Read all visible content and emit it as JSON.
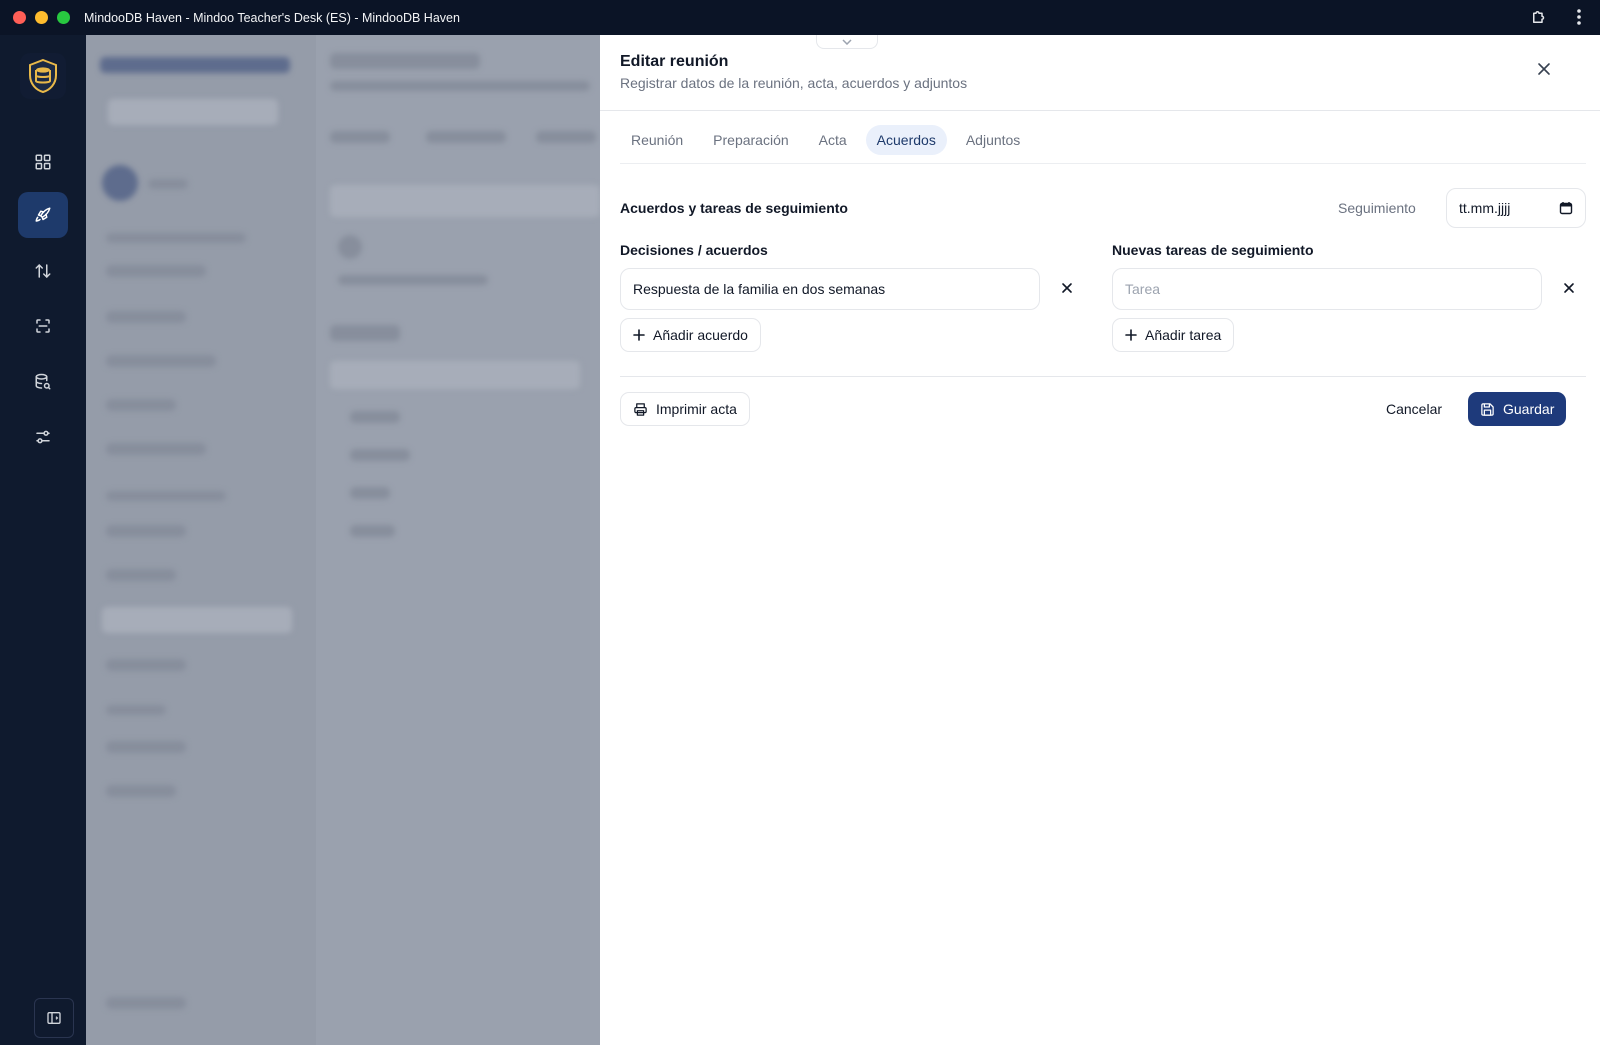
{
  "window": {
    "title": "MindooDB Haven - Mindoo Teacher's Desk (ES) - MindooDB Haven"
  },
  "sheet": {
    "title": "Editar reunión",
    "subtitle": "Registrar datos de la reunión, acta, acuerdos y adjuntos",
    "tabs": [
      {
        "label": "Reunión",
        "active": false
      },
      {
        "label": "Preparación",
        "active": false
      },
      {
        "label": "Acta",
        "active": false
      },
      {
        "label": "Acuerdos",
        "active": true
      },
      {
        "label": "Adjuntos",
        "active": false
      }
    ],
    "section_title": "Acuerdos y tareas de seguimiento",
    "followup": {
      "label": "Seguimiento",
      "date_value": "tt.mm.jjjj"
    },
    "decisions": {
      "label": "Decisiones / acuerdos",
      "items": [
        "Respuesta de la familia en dos semanas"
      ],
      "add_label": "Añadir acuerdo"
    },
    "tasks": {
      "label": "Nuevas tareas de seguimiento",
      "placeholder": "Tarea",
      "value": "",
      "add_label": "Añadir tarea"
    },
    "footer": {
      "print_label": "Imprimir acta",
      "cancel_label": "Cancelar",
      "save_label": "Guardar"
    }
  },
  "colors": {
    "accent": "#1e3a7b",
    "active_tab_bg": "#eaf0fb",
    "rail_active": "#1e3a6b"
  }
}
